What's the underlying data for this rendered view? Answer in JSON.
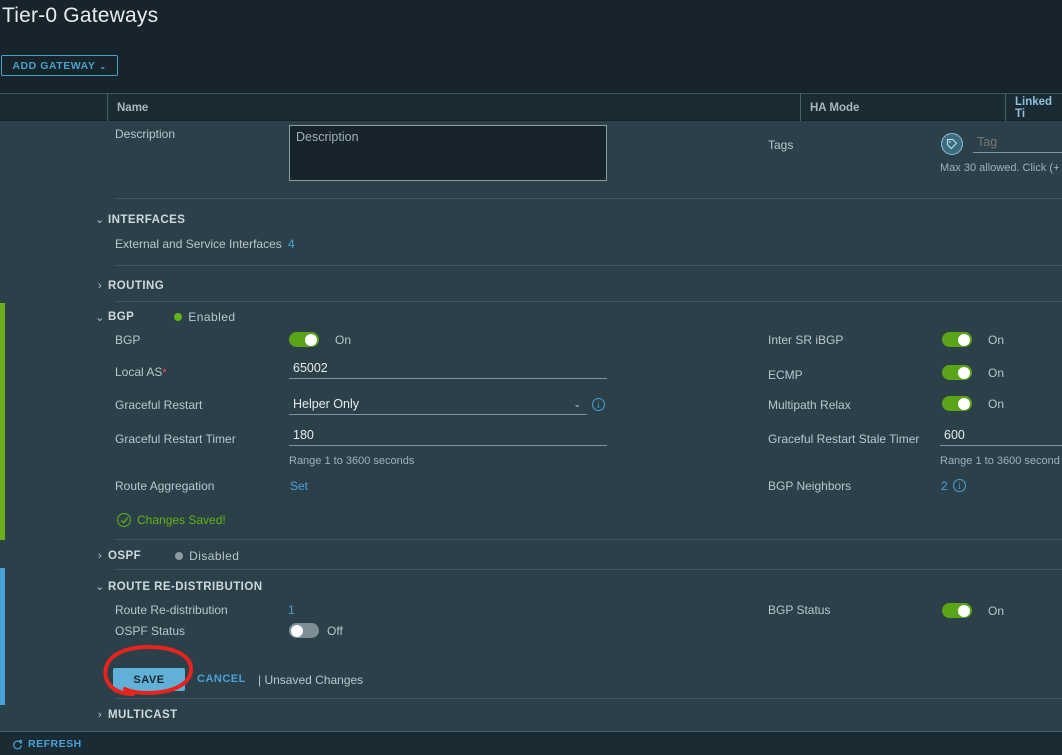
{
  "header": {
    "title": "Tier-0 Gateways",
    "add_gateway_label": "ADD GATEWAY",
    "caret": "⌄"
  },
  "table_header": {
    "columns": [
      "Name",
      "HA Mode",
      "Linked Ti"
    ]
  },
  "description_row": {
    "label": "Description",
    "placeholder": "Description",
    "value": ""
  },
  "tags": {
    "label": "Tags",
    "placeholder": "Tag",
    "value": "",
    "hint": "Max 30 allowed. Click (+"
  },
  "interfaces": {
    "title": "INTERFACES",
    "chevron": "⌄",
    "row_label": "External and Service Interfaces",
    "row_value": "4"
  },
  "routing": {
    "title": "ROUTING",
    "chevron": "›"
  },
  "bgp": {
    "title": "BGP",
    "chevron": "⌄",
    "status": "Enabled",
    "left": {
      "bgp_label": "BGP",
      "bgp_toggle_state": "On",
      "local_as_label": "Local AS",
      "local_as_value": "65002",
      "graceful_restart_label": "Graceful Restart",
      "graceful_restart_value": "Helper Only",
      "graceful_restart_timer_label": "Graceful Restart Timer",
      "graceful_restart_timer_value": "180",
      "graceful_restart_timer_hint": "Range 1 to 3600 seconds",
      "route_aggregation_label": "Route Aggregation",
      "route_aggregation_value": "Set",
      "changes_saved": "Changes Saved!"
    },
    "right": {
      "inter_sr_ibgp_label": "Inter SR iBGP",
      "inter_sr_ibgp_state": "On",
      "ecmp_label": "ECMP",
      "ecmp_state": "On",
      "multipath_relax_label": "Multipath Relax",
      "multipath_relax_state": "On",
      "stale_timer_label": "Graceful Restart Stale Timer",
      "stale_timer_value": "600",
      "stale_timer_hint": "Range 1 to 3600 second",
      "bgp_neighbors_label": "BGP Neighbors",
      "bgp_neighbors_value": "2"
    }
  },
  "ospf": {
    "title": "OSPF",
    "chevron": "›",
    "status": "Disabled"
  },
  "route_redistribution": {
    "title": "ROUTE RE-DISTRIBUTION",
    "chevron": "⌄",
    "row_label": "Route Re-distribution",
    "row_value": "1",
    "ospf_status_label": "OSPF Status",
    "ospf_status_state": "Off",
    "bgp_status_label": "BGP Status",
    "bgp_status_state": "On"
  },
  "actions": {
    "save_label": "SAVE",
    "cancel_label": "CANCEL",
    "unsaved_label": "| Unsaved Changes"
  },
  "multicast": {
    "title": "MULTICAST",
    "chevron": "›"
  },
  "footer": {
    "refresh_label": "REFRESH"
  },
  "colors": {
    "accent_blue": "#4aa1d8",
    "toggle_on_green": "#5aa417",
    "toggle_off_gray": "#7d8e95",
    "status_enabled_green": "#60b515",
    "status_disabled_gray": "#8d9ba1",
    "annotation_red": "#e8231e",
    "save_button_blue": "#61b0d7",
    "left_bar_green": "#6bb01c",
    "left_bar_blue": "#4aa1d8",
    "required_asterisk_red": "#e8524e"
  }
}
